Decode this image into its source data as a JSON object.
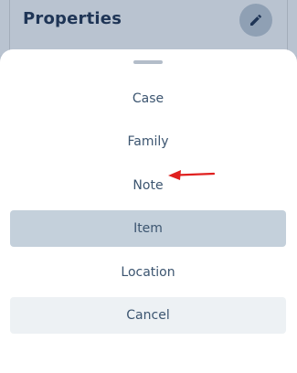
{
  "header": {
    "title": "Properties",
    "edit_icon": "pencil-icon"
  },
  "sheet": {
    "options": [
      {
        "label": "Case"
      },
      {
        "label": "Family"
      },
      {
        "label": "Note"
      },
      {
        "label": "Item",
        "selected": true
      },
      {
        "label": "Location"
      }
    ],
    "cancel_label": "Cancel"
  },
  "annotation": {
    "arrow_color": "#e0201f",
    "arrow_icon": "red-arrow-left-icon"
  },
  "colors": {
    "title": "#1f3556",
    "option_text": "#3c5570",
    "selected_bg": "#c4d0db",
    "cancel_bg": "#edf1f4"
  }
}
